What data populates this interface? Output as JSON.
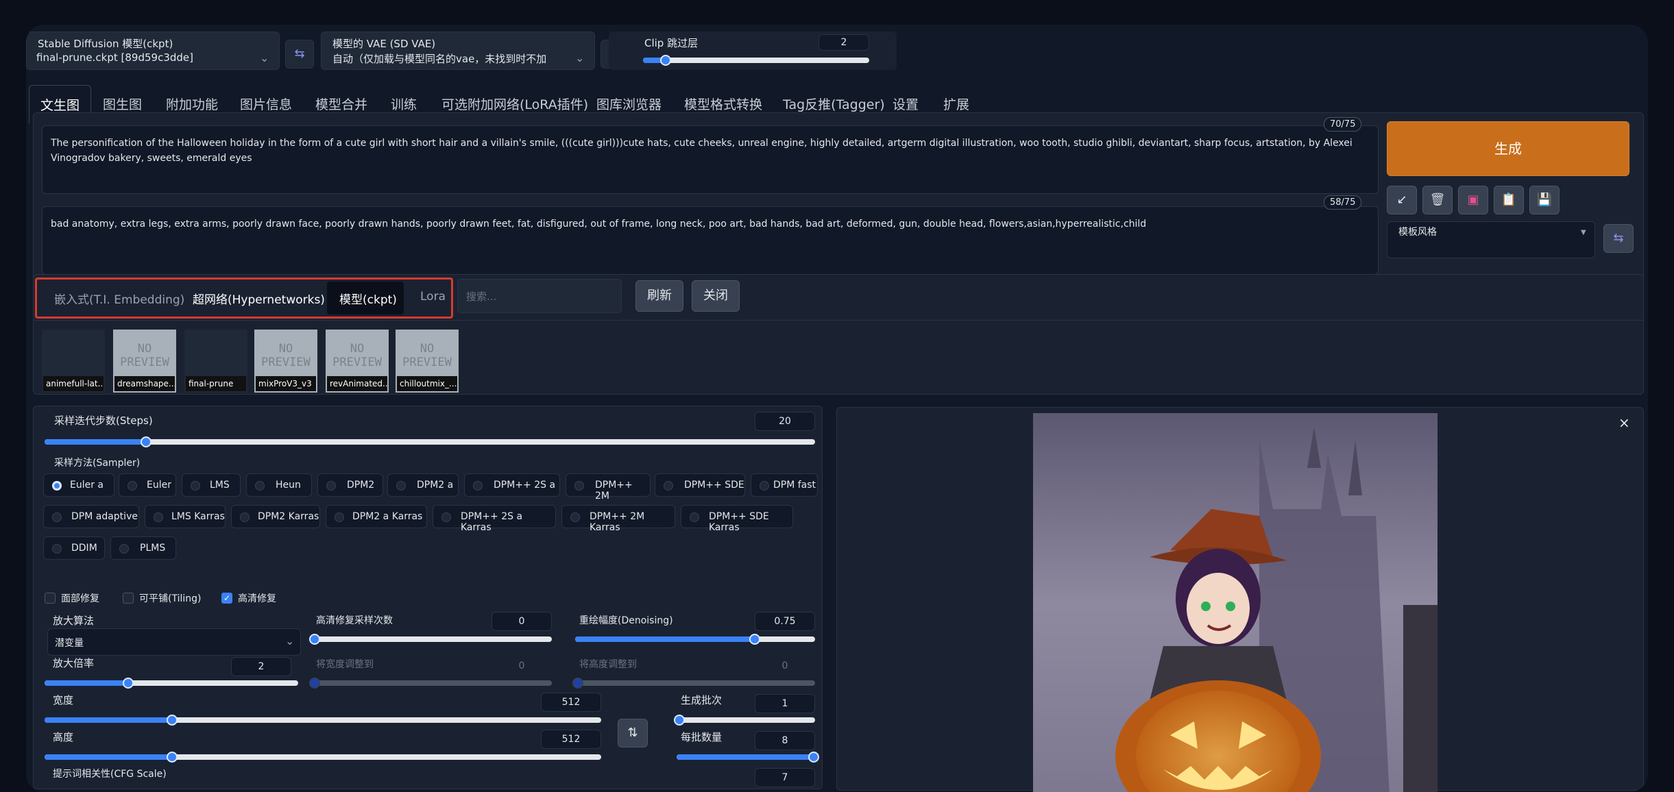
{
  "top": {
    "model_label": "Stable Diffusion 模型(ckpt)",
    "model_value": "final-prune.ckpt [89d59c3dde]",
    "vae_label": "模型的 VAE (SD VAE)",
    "vae_value": "自动（仅加载与模型同名的vae，未找到时不加",
    "clip_label": "Clip 跳过层",
    "clip_value": "2",
    "clip_fraction": 0.1
  },
  "tabs": [
    "文生图",
    "图生图",
    "附加功能",
    "图片信息",
    "模型合并",
    "训练",
    "可选附加网络(LoRA插件)",
    "图库浏览器",
    "模型格式转换",
    "Tag反推(Tagger)",
    "设置",
    "扩展"
  ],
  "prompt": {
    "positive": "The personification of the Halloween holiday in the form of a cute girl with short hair and a villain's smile, (((cute girl)))cute hats, cute cheeks, unreal engine, highly detailed, artgerm digital illustration, woo tooth, studio ghibli, deviantart, sharp focus, artstation, by Alexei Vinogradov bakery, sweets, emerald eyes",
    "positive_count": "70/75",
    "negative": "bad anatomy, extra legs, extra arms, poorly drawn face, poorly drawn hands, poorly drawn feet, fat, disfigured, out of frame, long neck, poo art, bad hands, bad art, deformed, gun, double head, flowers,asian,hyperrealistic,child",
    "negative_count": "58/75"
  },
  "generate_label": "生成",
  "styles_label": "模板风格",
  "action_icons": [
    "arrow-icon",
    "trash-icon",
    "art-icon",
    "clipboard-icon",
    "save-icon"
  ],
  "network_tabs": [
    "嵌入式(T.I. Embedding)",
    "超网络(Hypernetworks)",
    "模型(ckpt)",
    "Lora"
  ],
  "network_search_placeholder": "搜索...",
  "refresh_label": "刷新",
  "close_label": "关闭",
  "cards": [
    {
      "name": "animefull-lat...",
      "preview": false
    },
    {
      "name": "dreamshape...",
      "preview": true
    },
    {
      "name": "final-prune",
      "preview": false
    },
    {
      "name": "mixProV3_v3",
      "preview": true
    },
    {
      "name": "revAnimated...",
      "preview": true
    },
    {
      "name": "chilloutmix_...",
      "preview": true
    }
  ],
  "no_preview_text": "NO PREVIEW",
  "steps": {
    "label": "采样迭代步数(Steps)",
    "value": "20",
    "fraction": 0.13
  },
  "sampler": {
    "label": "采样方法(Sampler)",
    "options": [
      "Euler a",
      "Euler",
      "LMS",
      "Heun",
      "DPM2",
      "DPM2 a",
      "DPM++ 2S a",
      "DPM++ 2M",
      "DPM++ SDE",
      "DPM fast",
      "DPM adaptive",
      "LMS Karras",
      "DPM2 Karras",
      "DPM2 a Karras",
      "DPM++ 2S a Karras",
      "DPM++ 2M Karras",
      "DPM++ SDE Karras",
      "DDIM",
      "PLMS"
    ],
    "selected": "Euler a"
  },
  "checks": [
    {
      "label": "面部修复",
      "on": false
    },
    {
      "label": "可平铺(Tiling)",
      "on": false
    },
    {
      "label": "高清修复",
      "on": true
    }
  ],
  "upscaler": {
    "label": "放大算法",
    "value": "潜变量"
  },
  "hires_steps": {
    "label": "高清修复采样次数",
    "value": "0",
    "fraction": 0.0
  },
  "denoise": {
    "label": "重绘幅度(Denoising)",
    "value": "0.75",
    "fraction": 0.75
  },
  "scale": {
    "label": "放大倍率",
    "value": "2",
    "fraction": 0.33
  },
  "resize_w": {
    "label": "将宽度调整到",
    "value": "0"
  },
  "resize_h": {
    "label": "将高度调整到",
    "value": "0"
  },
  "width": {
    "label": "宽度",
    "value": "512",
    "fraction": 0.23
  },
  "height": {
    "label": "高度",
    "value": "512",
    "fraction": 0.23
  },
  "batch_count": {
    "label": "生成批次",
    "value": "1",
    "fraction": 0.0
  },
  "batch_size": {
    "label": "每批数量",
    "value": "8",
    "fraction": 1.0
  },
  "cfg": {
    "label": "提示词相关性(CFG Scale)",
    "value": "7"
  },
  "output_close": "×",
  "colors": {
    "accent": "#c96f1c",
    "slider": "#3b82f6",
    "highlight": "#d63b2f"
  }
}
